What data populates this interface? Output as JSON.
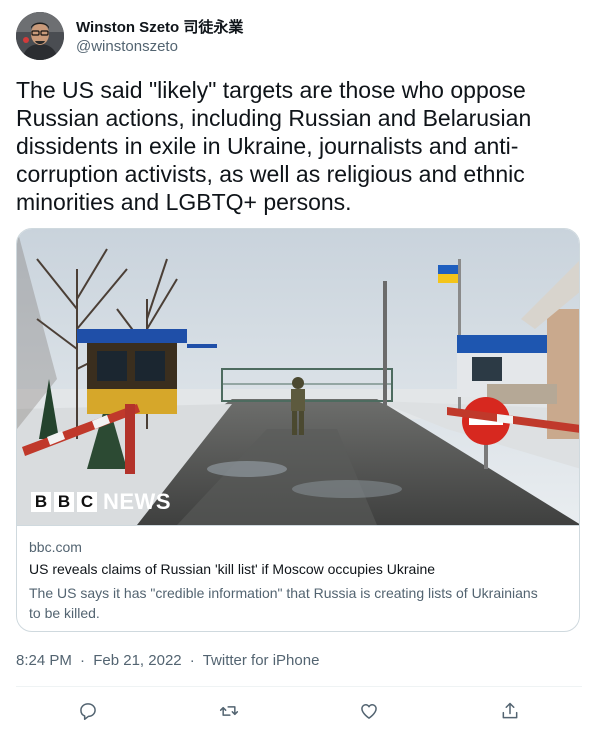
{
  "author": {
    "display_name": "Winston Szeto 司徒永業",
    "handle": "@winstonszeto"
  },
  "tweet": {
    "text": "The US said \"likely\" targets are those who oppose Russian actions, including Russian and Belarusian dissidents in exile in Ukraine, journalists and anti-corruption activists, as well as religious and ethnic minorities and LGBTQ+ persons."
  },
  "card": {
    "logo_letters": [
      "B",
      "B",
      "C"
    ],
    "logo_news": "NEWS",
    "domain": "bbc.com",
    "title": "US reveals claims of Russian 'kill list' if Moscow occupies Ukraine",
    "description": "The US says it has \"credible information\" that Russia is creating lists of Ukrainians to be killed."
  },
  "meta": {
    "time": "8:24 PM",
    "separator": "·",
    "date": "Feb 21, 2022",
    "source": "Twitter for iPhone"
  },
  "colors": {
    "text_primary": "#0f1419",
    "text_secondary": "#536471",
    "border": "#cfd9de"
  },
  "icons": [
    "reply-icon",
    "retweet-icon",
    "like-icon",
    "share-icon"
  ]
}
